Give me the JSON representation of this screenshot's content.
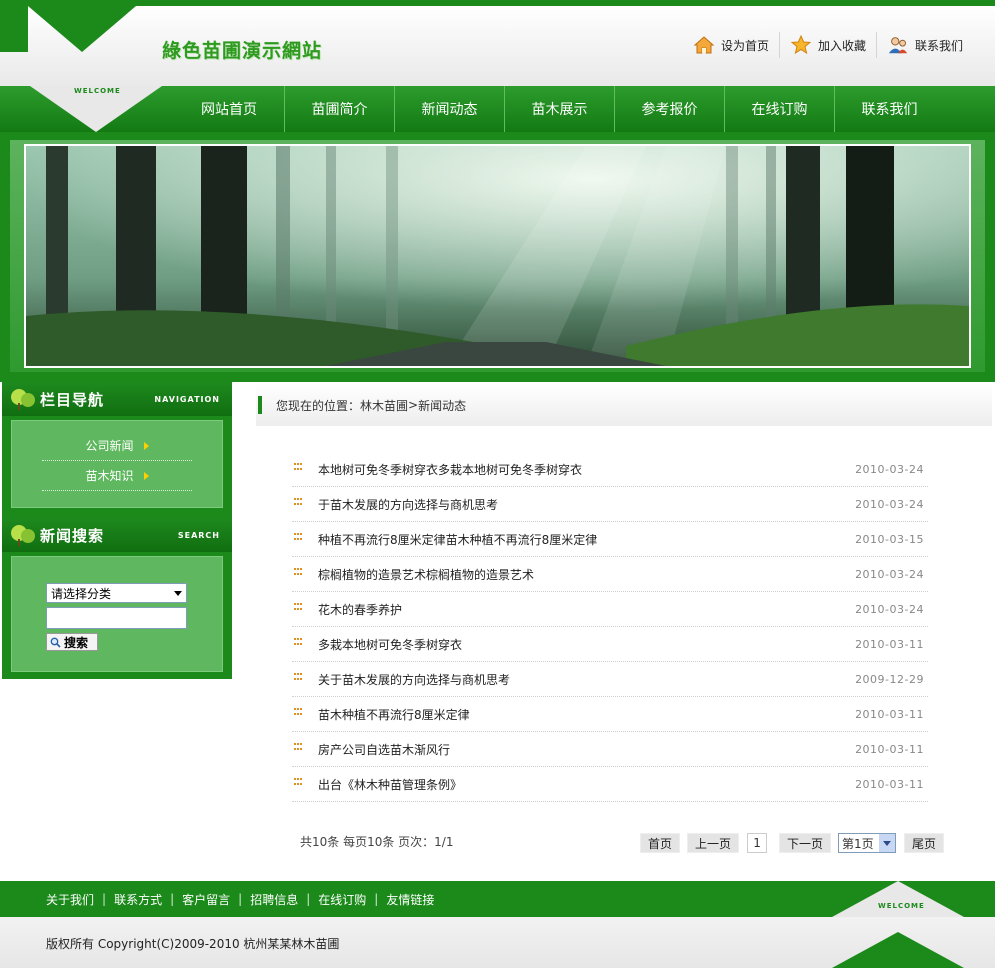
{
  "header": {
    "site_title": "綠色苗圃演示網站",
    "welcome": "WELCOME",
    "links": [
      {
        "label": "设为首页",
        "icon": "home-icon"
      },
      {
        "label": "加入收藏",
        "icon": "star-icon"
      },
      {
        "label": "联系我们",
        "icon": "contact-person-icon"
      }
    ]
  },
  "nav": {
    "items": [
      "网站首页",
      "苗圃简介",
      "新闻动态",
      "苗木展示",
      "参考报价",
      "在线订购",
      "联系我们"
    ]
  },
  "sidebar": {
    "nav_title": "栏目导航",
    "nav_title_en": "NAVIGATION",
    "menu": [
      "公司新闻",
      "苗木知识"
    ],
    "search_title": "新闻搜索",
    "search_title_en": "SEARCH",
    "category_select": "请选择分类",
    "keyword_value": "",
    "search_button": "搜索"
  },
  "breadcrumb": {
    "prefix": "您现在的位置：",
    "home": "林木苗圃",
    "sep": " > ",
    "current": "新闻动态"
  },
  "news": [
    {
      "title": "本地树可免冬季树穿衣多栽本地树可免冬季树穿衣",
      "date": "2010-03-24"
    },
    {
      "title": "于苗木发展的方向选择与商机思考",
      "date": "2010-03-24"
    },
    {
      "title": "种植不再流行8厘米定律苗木种植不再流行8厘米定律",
      "date": "2010-03-15"
    },
    {
      "title": "棕榈植物的造景艺术棕榈植物的造景艺术",
      "date": "2010-03-24"
    },
    {
      "title": "花木的春季养护",
      "date": "2010-03-24"
    },
    {
      "title": "多栽本地树可免冬季树穿衣",
      "date": "2010-03-11"
    },
    {
      "title": "关于苗木发展的方向选择与商机思考",
      "date": "2009-12-29"
    },
    {
      "title": "苗木种植不再流行8厘米定律",
      "date": "2010-03-11"
    },
    {
      "title": "房产公司自选苗木渐风行",
      "date": "2010-03-11"
    },
    {
      "title": "出台《林木种苗管理条例》",
      "date": "2010-03-11"
    }
  ],
  "pager": {
    "info": "共10条  每页10条  页次：1/1",
    "first": "首页",
    "prev": "上一页",
    "current_page": "1",
    "next": "下一页",
    "page_select": "第1页",
    "last": "尾页"
  },
  "footer": {
    "links": [
      "关于我们",
      "联系方式",
      "客户留言",
      "招聘信息",
      "在线订购",
      "友情链接"
    ],
    "copyright": "版权所有  Copyright(C)2009-2010 杭州某某林木苗圃",
    "welcome": "WELCOME"
  },
  "colors": {
    "brand_green": "#1b8a1b",
    "light_green": "#5fb85f",
    "accent_orange": "#e09020"
  }
}
